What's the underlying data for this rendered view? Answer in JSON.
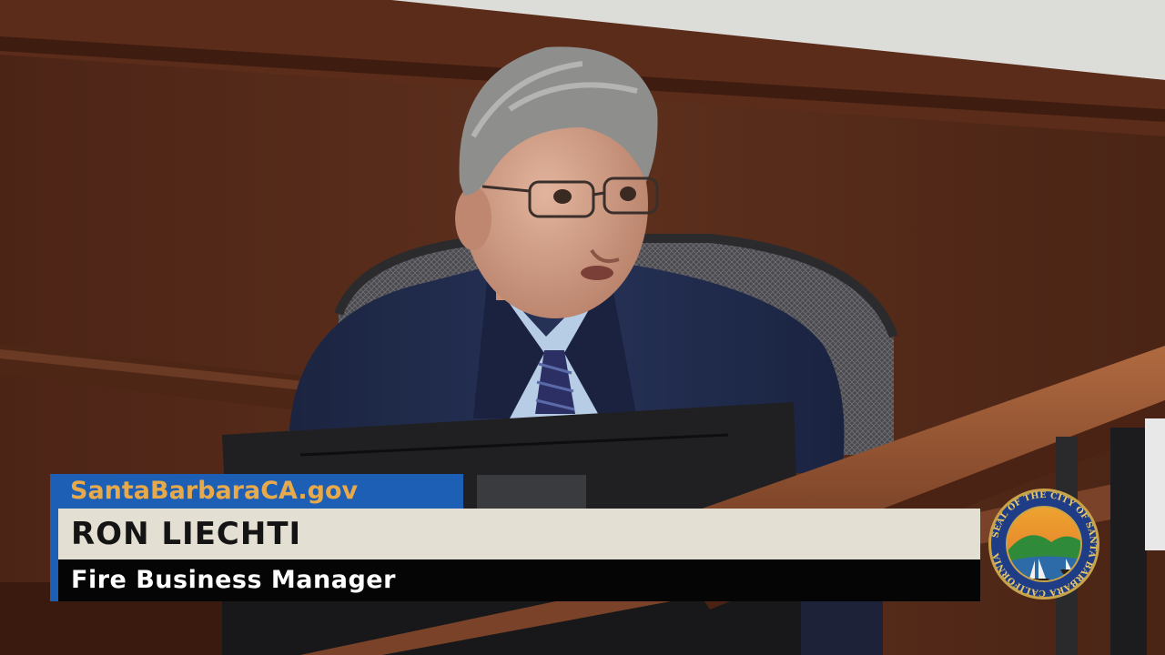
{
  "lower_third": {
    "website": "SantaBarbaraCA.gov",
    "speaker_name": "RON LIECHTI",
    "speaker_title": "Fire Business Manager"
  },
  "seal": {
    "text": "SEAL OF THE CITY OF SANTA BARBARA CALIFORNIA"
  },
  "colors": {
    "banner_blue": "#1d5fb5",
    "banner_orange": "#e7a94a",
    "name_bar": "#e4dfd3",
    "title_bar": "#050505",
    "wood_panel": "#5a2e1c",
    "suit_navy": "#1f2a44"
  }
}
